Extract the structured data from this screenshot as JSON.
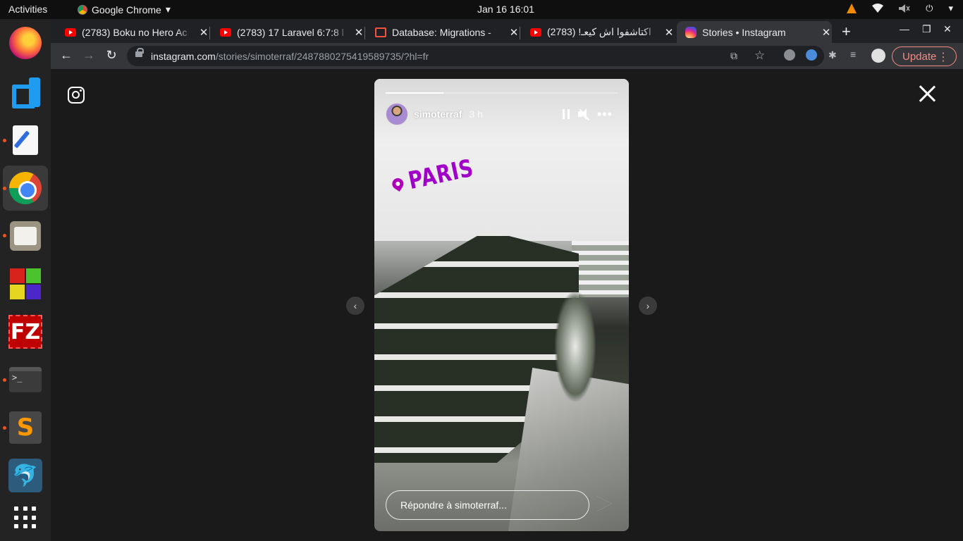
{
  "topbar": {
    "activities": "Activities",
    "app_name": "Google Chrome",
    "app_menu_caret": "▾",
    "clock": "Jan 16  16:01",
    "tray": {
      "wifi": "wifi-icon",
      "volume": "volume-icon",
      "power": "power-icon",
      "power_glyph": "⏻",
      "caret": "▾"
    }
  },
  "dock": {
    "items": [
      {
        "name": "firefox"
      },
      {
        "name": "vscode"
      },
      {
        "name": "text-editor"
      },
      {
        "name": "chrome"
      },
      {
        "name": "files"
      },
      {
        "name": "blocks-game"
      },
      {
        "name": "filezilla",
        "glyph": "FZ"
      },
      {
        "name": "terminal",
        "glyph": ">_"
      },
      {
        "name": "sublime-text",
        "glyph": "S"
      },
      {
        "name": "mysql-workbench",
        "glyph": "🐬"
      },
      {
        "name": "show-applications"
      }
    ]
  },
  "tabs": [
    {
      "title": "(2783) Boku no Hero Ac",
      "icon": "youtube",
      "close": "✕"
    },
    {
      "title": "(2783) 17 Laravel 6:7:8 l",
      "icon": "youtube",
      "close": "✕"
    },
    {
      "title": "Database: Migrations -",
      "icon": "laravel",
      "close": "✕"
    },
    {
      "title": "(2783) !اكتاشفوا اش كيعـ",
      "icon": "youtube",
      "close": "✕"
    },
    {
      "title": "Stories • Instagram",
      "icon": "instagram",
      "close": "✕",
      "active": true
    }
  ],
  "tabstrip": {
    "new_tab": "+",
    "minimize": "—",
    "maximize": "❐",
    "close": "✕"
  },
  "toolbar": {
    "back": "←",
    "forward": "→",
    "reload": "↻",
    "url_host": "instagram.com",
    "url_path": "/stories/simoterraf/2487880275419589735/?hl=fr",
    "translate_icon": "⧉",
    "star_icon": "☆",
    "puzzle_icon": "✱",
    "media_icon": "≡",
    "update_label": "Update",
    "menu_dots": "⋮"
  },
  "story": {
    "username": "simoterraf",
    "time": "3 h",
    "progress": 0.25,
    "sticker_text": "PARIS",
    "reply_placeholder": "Répondre à simoterraf...",
    "more_glyph": "•••",
    "prev_glyph": "‹",
    "next_glyph": "›"
  }
}
